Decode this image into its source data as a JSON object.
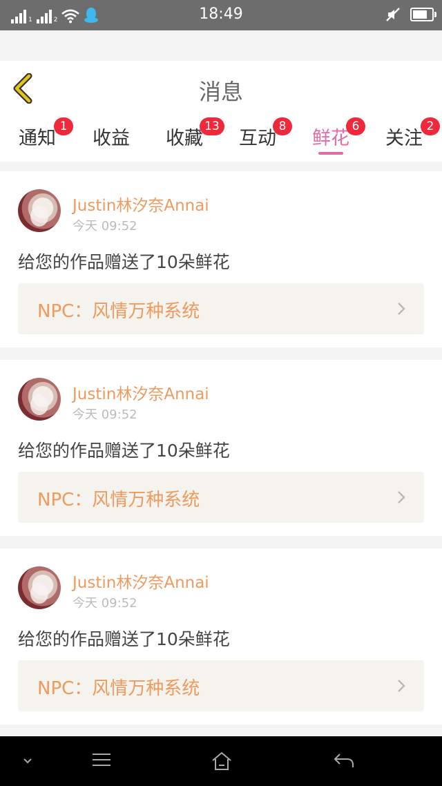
{
  "status_bar": {
    "time": "18:49",
    "sim1_label": "1",
    "sim2_label": "2",
    "icons": [
      "signal-icon",
      "wifi-icon",
      "qq-icon",
      "mute-icon",
      "battery-icon"
    ]
  },
  "header": {
    "title": "消息",
    "back_icon": "chevron-left-icon",
    "accent_color": "#e6c31f"
  },
  "tabs": [
    {
      "label": "通知",
      "badge": "1",
      "active": false
    },
    {
      "label": "收益",
      "badge": "",
      "active": false
    },
    {
      "label": "收藏",
      "badge": "13",
      "active": false
    },
    {
      "label": "互动",
      "badge": "8",
      "active": false
    },
    {
      "label": "鲜花",
      "badge": "6",
      "active": true
    },
    {
      "label": "关注",
      "badge": "2",
      "active": false
    }
  ],
  "colors": {
    "active_tab": "#e36aa4",
    "badge": "#f0283c",
    "username": "#ee9a5e",
    "npc_text": "#ee9a5e",
    "npc_bg": "#f5f3ed"
  },
  "messages": [
    {
      "username": "Justin林汐奈Annai",
      "time": "今天 09:52",
      "text": "给您的作品赠送了10朵鲜花",
      "npc": "NPC：风情万种系统"
    },
    {
      "username": "Justin林汐奈Annai",
      "time": "今天 09:52",
      "text": "给您的作品赠送了10朵鲜花",
      "npc": "NPC：风情万种系统"
    },
    {
      "username": "Justin林汐奈Annai",
      "time": "今天 09:52",
      "text": "给您的作品赠送了10朵鲜花",
      "npc": "NPC：风情万种系统"
    }
  ],
  "nav_bar": {
    "icons": [
      "chevron-down-icon",
      "menu-icon",
      "home-icon",
      "back-arrow-icon"
    ]
  }
}
